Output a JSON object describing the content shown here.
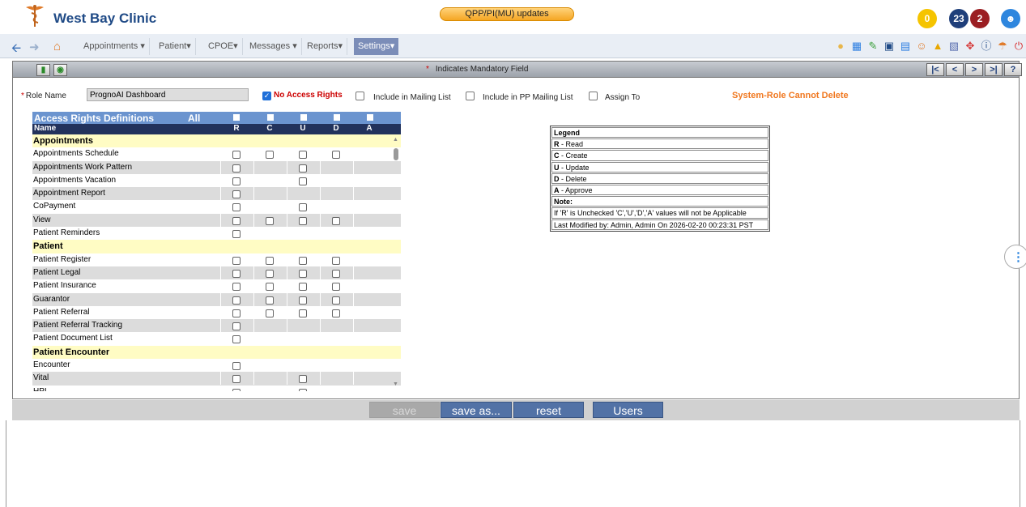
{
  "header": {
    "clinic_name": "West Bay Clinic",
    "updates_label": "QPP/PI(MU) updates",
    "badges": [
      "0",
      "23",
      "2"
    ],
    "user_icon": "user-icon"
  },
  "nav": {
    "menus": [
      "Appointments ▾",
      "Patient▾",
      "CPOE▾",
      "Messages ▾",
      "Reports▾",
      "Settings▾"
    ]
  },
  "toolbar": {
    "mandatory_note": "Indicates Mandatory Field",
    "asterisk": "*",
    "paging": [
      "|<",
      "<",
      ">",
      ">|",
      "?"
    ]
  },
  "role": {
    "label": "Role Name",
    "value": "PrognoAI Dashboard",
    "no_access": "No Access Rights",
    "include_mailing": "Include in Mailing List",
    "include_pp_mailing": "Include in PP Mailing List",
    "assign_to": "Assign To",
    "system_role_msg": "System-Role Cannot Delete"
  },
  "table": {
    "title": "Access Rights Definitions",
    "all_label": "All",
    "name_header": "Name",
    "columns": [
      "R",
      "C",
      "U",
      "D",
      "A"
    ],
    "rows": [
      {
        "name": "Appointments",
        "group": true,
        "cols": []
      },
      {
        "name": "Appointments Schedule",
        "cols": [
          "R",
          "C",
          "U",
          "D"
        ]
      },
      {
        "name": "Appointments Work Pattern",
        "cols": [
          "R",
          "U"
        ]
      },
      {
        "name": "Appointments Vacation",
        "cols": [
          "R",
          "U"
        ]
      },
      {
        "name": "Appointment Report",
        "cols": [
          "R"
        ]
      },
      {
        "name": "CoPayment",
        "cols": [
          "R",
          "U"
        ]
      },
      {
        "name": "View",
        "cols": [
          "R",
          "C",
          "U",
          "D"
        ]
      },
      {
        "name": "Patient Reminders",
        "cols": [
          "R"
        ]
      },
      {
        "name": "Patient",
        "group": true,
        "cols": []
      },
      {
        "name": "Patient Register",
        "cols": [
          "R",
          "C",
          "U",
          "D"
        ]
      },
      {
        "name": "Patient Legal",
        "cols": [
          "R",
          "C",
          "U",
          "D"
        ]
      },
      {
        "name": "Patient Insurance",
        "cols": [
          "R",
          "C",
          "U",
          "D"
        ]
      },
      {
        "name": "Guarantor",
        "cols": [
          "R",
          "C",
          "U",
          "D"
        ]
      },
      {
        "name": "Patient Referral",
        "cols": [
          "R",
          "C",
          "U",
          "D"
        ]
      },
      {
        "name": "Patient Referral Tracking",
        "cols": [
          "R"
        ]
      },
      {
        "name": "Patient Document List",
        "cols": [
          "R"
        ]
      },
      {
        "name": "Patient Encounter",
        "group": true,
        "cols": []
      },
      {
        "name": "Encounter",
        "cols": [
          "R"
        ]
      },
      {
        "name": "Vital",
        "cols": [
          "R",
          "U"
        ]
      },
      {
        "name": "HPI",
        "cols": [
          "R",
          "U"
        ]
      }
    ]
  },
  "legend": {
    "title": "Legend",
    "items": [
      {
        "key": "R",
        "text": " - Read"
      },
      {
        "key": "C",
        "text": " - Create"
      },
      {
        "key": "U",
        "text": " - Update"
      },
      {
        "key": "D",
        "text": " - Delete"
      },
      {
        "key": "A",
        "text": " - Approve"
      }
    ],
    "note_label": "Note:",
    "note_text": "If 'R' is Unchecked 'C','U','D','A' values will not be Applicable",
    "last_modified": "Last Modified by: Admin, Admin On 2026-02-20 00:23:31 PST"
  },
  "buttons": {
    "save": "save",
    "save_as": "save as...",
    "reset": "reset",
    "users": "Users"
  },
  "colors": {
    "brand": "#1f4a86",
    "table_header": "#6b94cf",
    "group_row": "#fffcc4",
    "warning": "#f07820"
  }
}
